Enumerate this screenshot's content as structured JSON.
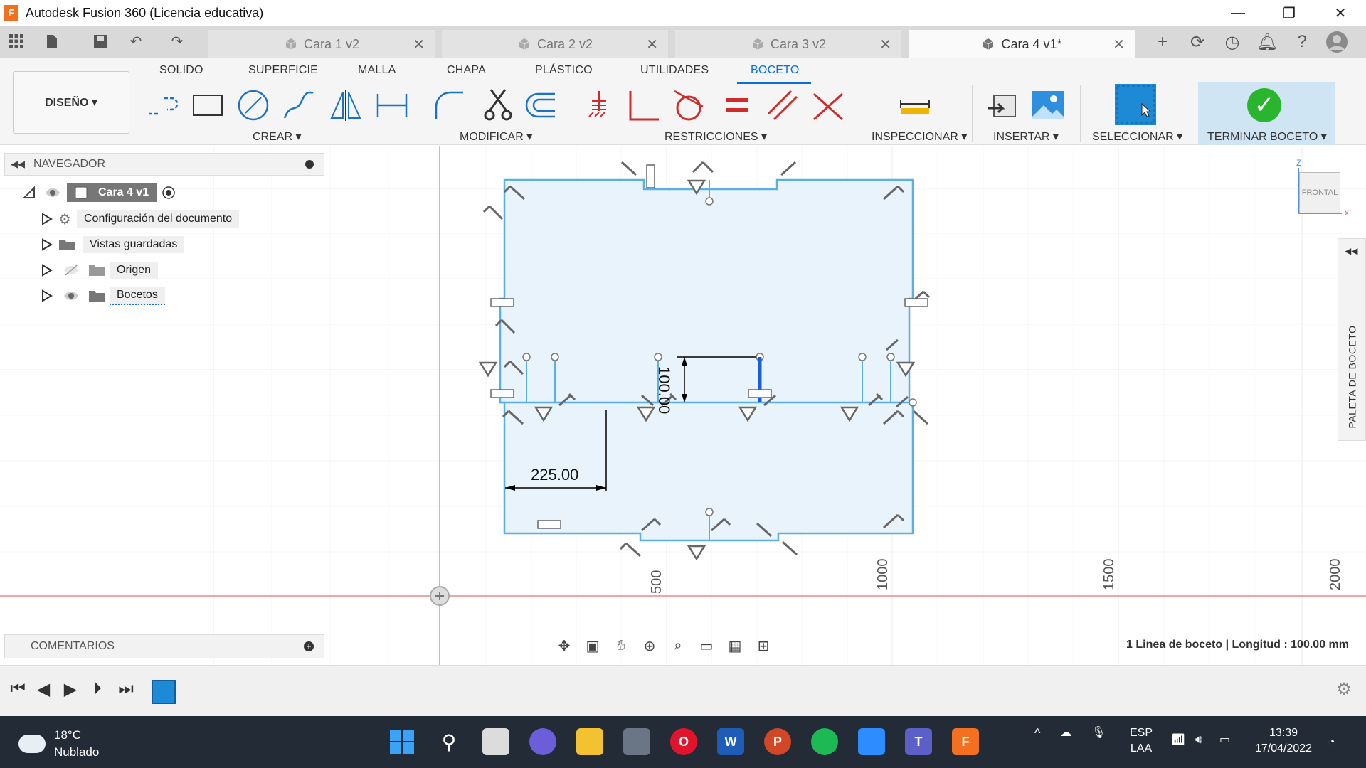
{
  "window": {
    "title": "Autodesk Fusion 360 (Licencia educativa)",
    "logo": "F",
    "controls": [
      "—",
      "❐",
      "✕"
    ]
  },
  "tabs": [
    {
      "label": "Cara 1 v2",
      "active": false
    },
    {
      "label": "Cara 2 v2",
      "active": false
    },
    {
      "label": "Cara 3 v2",
      "active": false
    },
    {
      "label": "Cara 4 v1*",
      "active": true
    }
  ],
  "ribbon": {
    "tabs": [
      "SOLIDO",
      "SUPERFICIE",
      "MALLA",
      "CHAPA",
      "PLÁSTICO",
      "UTILIDADES",
      "BOCETO"
    ],
    "active_tab": "BOCETO",
    "workspace": "DISEÑO ▾",
    "groups": {
      "crear": "CREAR ▾",
      "modificar": "MODIFICAR ▾",
      "restricciones": "RESTRICCIONES ▾",
      "inspeccionar": "INSPECCIONAR ▾",
      "insertar": "INSERTAR ▾",
      "seleccionar": "SELECCIONAR ▾",
      "terminar": "TERMINAR BOCETO ▾"
    }
  },
  "navigator": {
    "title": "NAVEGADOR",
    "root": "Cara 4 v1",
    "items": [
      "Configuración del documento",
      "Vistas guardadas",
      "Origen",
      "Bocetos"
    ]
  },
  "comments": {
    "title": "COMENTARIOS"
  },
  "viewcube": {
    "face": "FRONTAL",
    "axis_z": "Z",
    "axis_x": "x"
  },
  "palette": {
    "label": "PALETA DE BOCETO"
  },
  "sketch": {
    "dimension_horizontal": "225.00",
    "dimension_vertical": "100.00",
    "ruler_labels": [
      "500",
      "1000",
      "1500",
      "2000"
    ]
  },
  "status": {
    "selection": "1 Linea de boceto | Longitud : 100.00 mm"
  },
  "taskbar": {
    "weather_temp": "18°C",
    "weather_desc": "Nublado",
    "lang_1": "ESP",
    "lang_2": "LAA",
    "time": "13:39",
    "date": "17/04/2022"
  },
  "colors": {
    "accent": "#0a6fd8",
    "sketch_fill": "#e8f3fb",
    "sketch_line": "#5ab0e0",
    "selected_line": "#1a5fd8",
    "taskbar": "#222b36"
  }
}
